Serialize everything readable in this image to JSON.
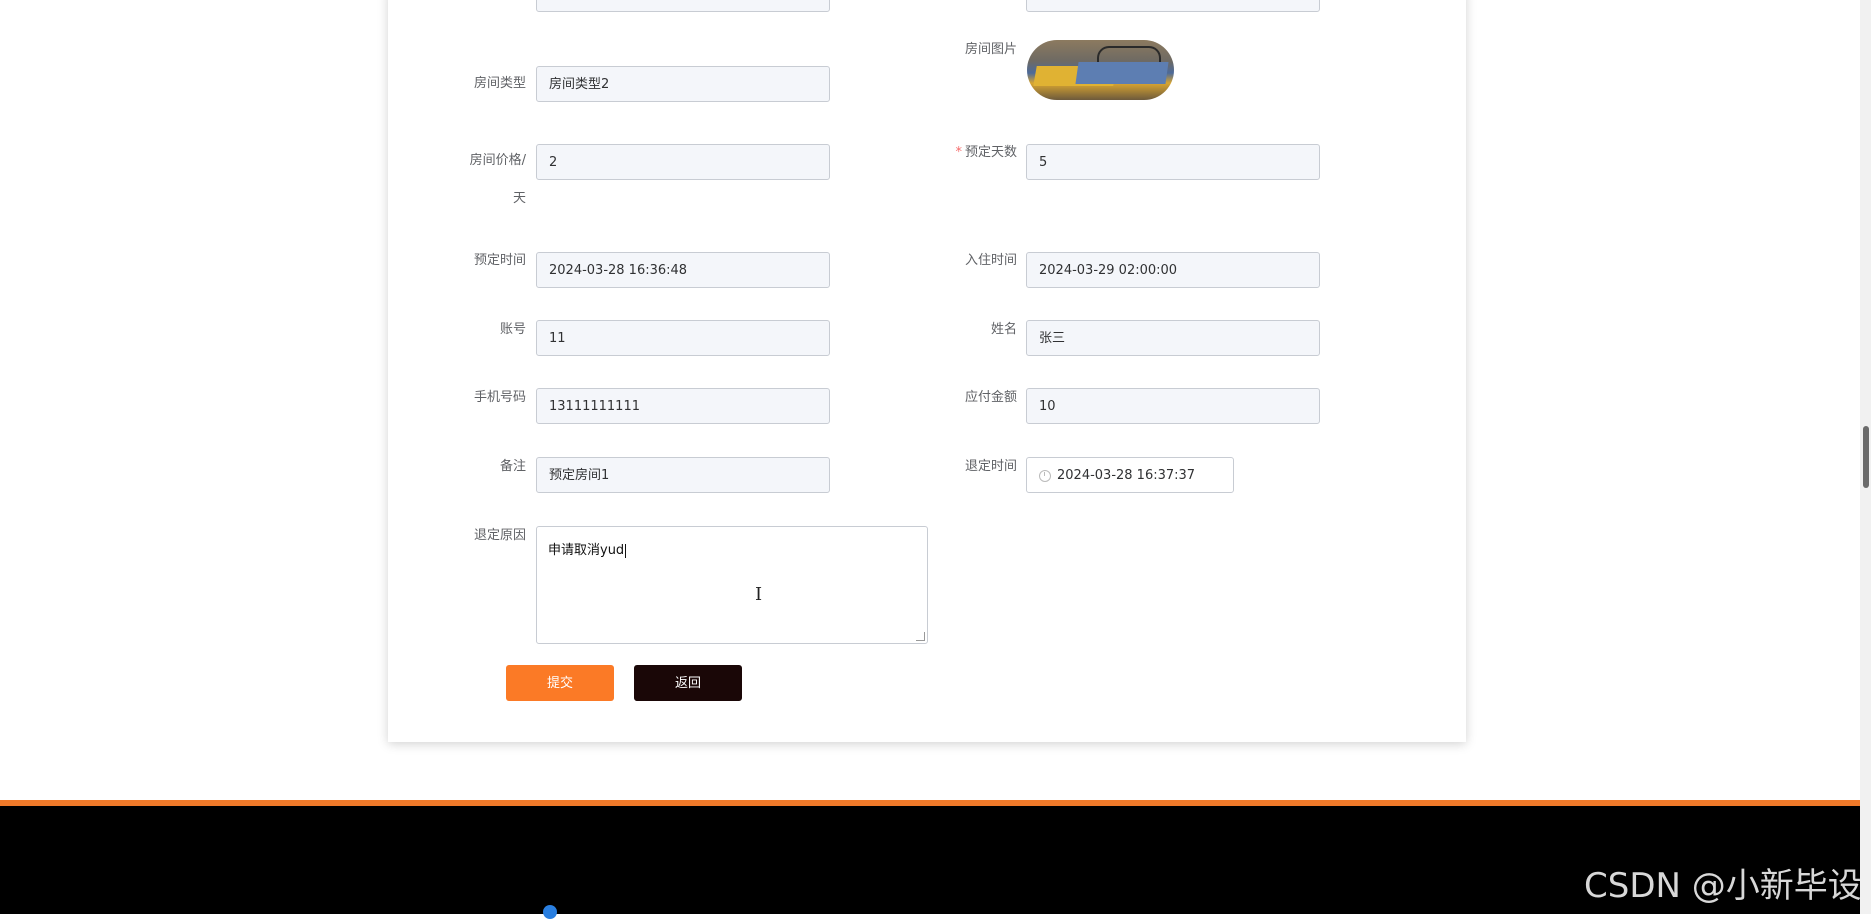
{
  "form": {
    "room_type": {
      "label": "房间类型",
      "value": "房间类型2"
    },
    "room_image": {
      "label": "房间图片"
    },
    "room_price": {
      "label_line1": "房间价格/",
      "label_line2": "天",
      "value": "2"
    },
    "book_days": {
      "required_mark": "*",
      "label": "预定天数",
      "value": "5"
    },
    "book_time": {
      "label": "预定时间",
      "value": "2024-03-28 16:36:48"
    },
    "checkin_time": {
      "label": "入住时间",
      "value": "2024-03-29 02:00:00"
    },
    "account": {
      "label": "账号",
      "value": "11"
    },
    "name": {
      "label": "姓名",
      "value": "张三"
    },
    "phone": {
      "label": "手机号码",
      "value": "13111111111"
    },
    "amount": {
      "label": "应付金额",
      "value": "10"
    },
    "remark": {
      "label": "备注",
      "value": "预定房间1"
    },
    "cancel_time": {
      "label": "退定时间",
      "value": "2024-03-28 16:37:37"
    },
    "cancel_reason": {
      "label": "退定原因",
      "value": "申请取消yud"
    }
  },
  "buttons": {
    "submit": "提交",
    "back": "返回"
  },
  "colors": {
    "primary": "#fb7a26",
    "dark": "#1a0707",
    "footer_line": "#f07a2a"
  },
  "watermark": "CSDN @小新毕设"
}
